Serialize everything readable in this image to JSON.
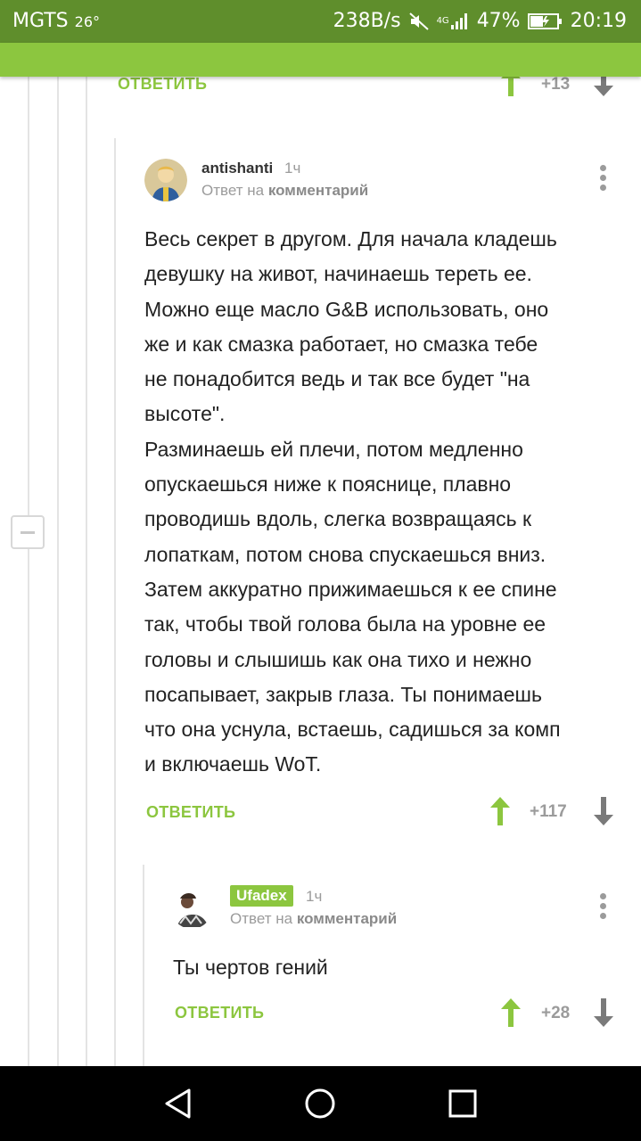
{
  "status_bar": {
    "carrier": "MGTS",
    "temperature": "26°",
    "net_speed": "238B/s",
    "network": "4G",
    "battery": "47%",
    "time": "20:19"
  },
  "colors": {
    "accent": "#8cc63f",
    "status_bar": "#5f8e2c",
    "muted": "#9b9b9b"
  },
  "top_comment": {
    "reply_label": "ОТВЕТИТЬ",
    "rating": "+13"
  },
  "comment1": {
    "username": "antishanti",
    "time": "1ч",
    "reply_prefix": "Ответ на",
    "reply_target": "комментарий",
    "text": "Весь секрет в другом. Для начала кладешь\nдевушку на живот, начинаешь тереть ее.\nМожно еще масло G&B использовать, оно\nже и как смазка работает, но смазка тебе\nне понадобится ведь и так все будет \"на\nвысоте\".\nРазминаешь ей плечи, потом медленно\nопускаешься ниже к пояснице, плавно\nпроводишь вдоль, слегка возвращаясь к\nлопаткам, потом снова спускаешься вниз.\nЗатем аккуратно прижимаешься к ее спине\nтак, чтобы твой голова была на уровне ее\nголовы и слышишь как она тихо и нежно\nпосапывает, закрыв глаза. Ты понимаешь\nчто она уснула, встаешь, садишься за комп\nи включаешь WoT.",
    "reply_label": "ОТВЕТИТЬ",
    "rating": "+117"
  },
  "comment2": {
    "username": "Ufadex",
    "time": "1ч",
    "reply_prefix": "Ответ на",
    "reply_target": "комментарий",
    "text": "Ты чертов гений",
    "reply_label": "ОТВЕТИТЬ",
    "rating": "+28"
  }
}
